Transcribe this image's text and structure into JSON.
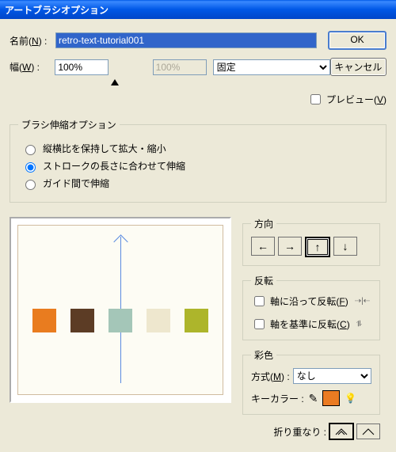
{
  "title": "アートブラシオプション",
  "labels": {
    "name": "名前",
    "nameKey": "N",
    "width": "幅",
    "widthKey": "W",
    "preview": "プレビュー",
    "previewKey": "V"
  },
  "fields": {
    "name": "retro-text-tutorial001",
    "width1": "100%",
    "width2": "100%",
    "scaleMode": "固定"
  },
  "buttons": {
    "ok": "OK",
    "cancel": "キャンセル"
  },
  "stretch": {
    "legend": "ブラシ伸縮オプション",
    "opt1": "縦横比を保持して拡大・縮小",
    "opt2": "ストロークの長さに合わせて伸縮",
    "opt3": "ガイド間で伸縮"
  },
  "direction": {
    "legend": "方向"
  },
  "flip": {
    "legend": "反転",
    "along": "軸に沿って反転",
    "alongKey": "F",
    "across": "軸を基準に反転",
    "acrossKey": "C"
  },
  "color": {
    "legend": "彩色",
    "method": "方式",
    "methodKey": "M",
    "methodValue": "なし",
    "keyColor": "キーカラー :",
    "keySwatch": "#EB7B22"
  },
  "overlap": {
    "label": "折り重なり :"
  },
  "swatches": [
    "#E97C1F",
    "#5C3C25",
    "#A4C6B8",
    "#EEE7CE",
    "#ADB52B"
  ]
}
